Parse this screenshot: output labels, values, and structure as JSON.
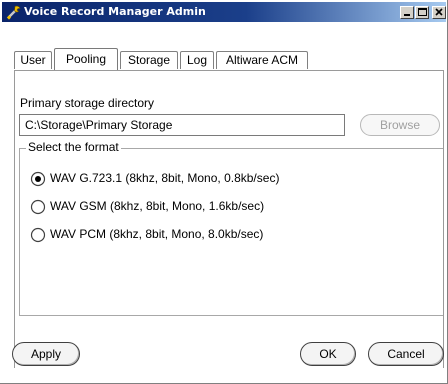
{
  "window": {
    "title": "Voice Record Manager Admin"
  },
  "tabs": [
    {
      "label": "User",
      "active": false
    },
    {
      "label": "Pooling",
      "active": true
    },
    {
      "label": "Storage",
      "active": false
    },
    {
      "label": "Log",
      "active": false
    },
    {
      "label": "Altiware ACM",
      "active": false
    }
  ],
  "storage": {
    "directory_label": "Primary storage directory",
    "directory_value": "C:\\Storage\\Primary Storage",
    "browse_label": "Browse",
    "browse_enabled": false
  },
  "format": {
    "group_label": "Select the format",
    "options": [
      {
        "label": "WAV G.723.1 (8khz, 8bit, Mono, 0.8kb/sec)",
        "selected": true
      },
      {
        "label": "WAV GSM (8khz, 8bit, Mono, 1.6kb/sec)",
        "selected": false
      },
      {
        "label": "WAV PCM (8khz, 8bit, Mono, 8.0kb/sec)",
        "selected": false
      }
    ]
  },
  "buttons": {
    "apply": "Apply",
    "ok": "OK",
    "cancel": "Cancel"
  },
  "colors": {
    "titlebar_start": "#0a246a",
    "titlebar_end": "#a6caf0"
  },
  "icons": [
    "wrench-tool-icon",
    "minimize-icon",
    "maximize-icon",
    "close-icon",
    "radio-selected-icon",
    "radio-unselected-icon"
  ]
}
